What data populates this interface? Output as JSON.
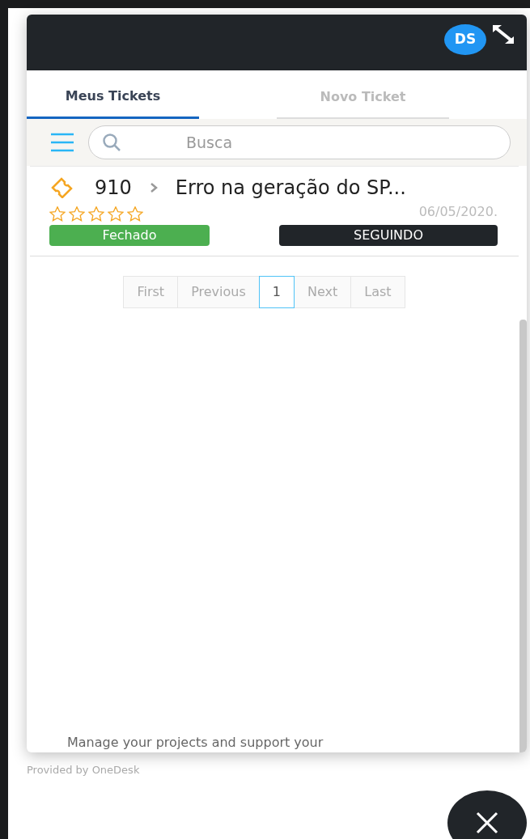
{
  "header": {
    "avatar": "DS"
  },
  "tabs": [
    {
      "label": "Meus Tickets",
      "selected": true
    },
    {
      "label": "Novo Ticket",
      "selected": false
    }
  ],
  "search": {
    "placeholder": "Busca"
  },
  "tickets": [
    {
      "number": "910",
      "title": "Erro na geração do SP...",
      "stars": 0,
      "date": "06/05/2020.",
      "status": "Fechado",
      "color": "#4caf50",
      "follow": "SEGUINDO"
    }
  ],
  "pagination": [
    {
      "label": "First",
      "selected": false
    },
    {
      "label": "Previous",
      "selected": false
    },
    {
      "label": "1",
      "selected": true
    },
    {
      "label": "Next",
      "selected": false
    },
    {
      "label": "Last",
      "selected": false
    }
  ],
  "footer_text": "Manage your projects and support your",
  "provided_by": "Provided by OneDesk"
}
